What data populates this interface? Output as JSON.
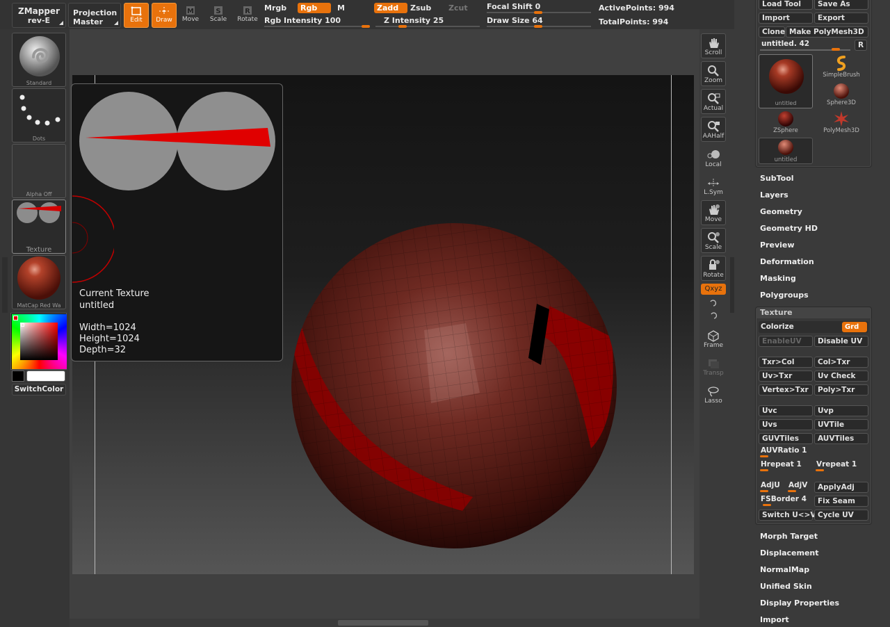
{
  "topbar": {
    "zmapper_label": "ZMapper",
    "zmapper_sub": "rev-E",
    "projection_label": "Projection",
    "projection_sub": "Master",
    "modes": [
      {
        "label": "Edit",
        "active": true
      },
      {
        "label": "Draw",
        "active": true
      },
      {
        "label": "Move",
        "active": false
      },
      {
        "label": "Scale",
        "active": false
      },
      {
        "label": "Rotate",
        "active": false
      }
    ],
    "mrgb": "Mrgb",
    "rgb": "Rgb",
    "m": "M",
    "rgb_intensity": "Rgb Intensity 100",
    "zadd": "Zadd",
    "zsub": "Zsub",
    "zcut": "Zcut",
    "z_intensity": "Z Intensity 25",
    "focal_shift": "Focal Shift 0",
    "draw_size": "Draw Size 64",
    "active_points": "ActivePoints: 994",
    "total_points": "TotalPoints: 994"
  },
  "left_shelf": {
    "standard": "Standard",
    "dots": "Dots",
    "alpha_off": "Alpha Off",
    "texture": "Texture",
    "matcap": "MatCap Red Wa",
    "switch_color": "SwitchColor"
  },
  "popup": {
    "title": "Current Texture",
    "name": "untitled",
    "width": "Width=1024",
    "height": "Height=1024",
    "depth": "Depth=32"
  },
  "right_shelf": [
    {
      "label": "Scroll",
      "icon": "hand-scroll-icon"
    },
    {
      "label": "Zoom",
      "icon": "zoom-icon"
    },
    {
      "label": "Actual",
      "icon": "actual-size-icon"
    },
    {
      "label": "AAHalf",
      "icon": "aahalf-icon"
    },
    {
      "label": "Local",
      "icon": "local-icon"
    },
    {
      "label": "L.Sym",
      "icon": "lsym-icon"
    },
    {
      "label": "Move",
      "icon": "move-hand-icon"
    },
    {
      "label": "Scale",
      "icon": "scale-icon"
    },
    {
      "label": "Rotate",
      "icon": "rotate-icon"
    },
    {
      "label": "Qxyz",
      "icon": "xyz-icon"
    },
    {
      "label": "Frame",
      "icon": "frame-icon"
    },
    {
      "label": "Transp",
      "icon": "transp-icon"
    },
    {
      "label": "Lasso",
      "icon": "lasso-icon"
    }
  ],
  "tool_palette": {
    "load_tool": "Load Tool",
    "save_as": "Save As",
    "import": "Import",
    "export": "Export",
    "clone": "Clone",
    "make_polymesh": "Make PolyMesh3D",
    "current": "untitled. 42",
    "r": "R",
    "tools": [
      {
        "label": "untitled",
        "icon": "sphere-icon"
      },
      {
        "label": "SimpleBrush",
        "icon": "simplebrush-icon"
      },
      {
        "label": "Sphere3D",
        "icon": "sphere3d-icon"
      },
      {
        "label": "ZSphere",
        "icon": "zsphere-icon"
      },
      {
        "label": "PolyMesh3D",
        "icon": "polymesh-star-icon"
      },
      {
        "label": "untitled",
        "icon": "sphere-small-icon"
      }
    ]
  },
  "menus_top": [
    "SubTool",
    "Layers",
    "Geometry",
    "Geometry HD",
    "Preview",
    "Deformation",
    "Masking",
    "Polygroups"
  ],
  "texture_panel": {
    "title": "Texture",
    "colorize": "Colorize",
    "grd": "Grd",
    "enable_uv": "EnableUV",
    "disable_uv": "Disable UV",
    "txr_col": "Txr>Col",
    "col_txr": "Col>Txr",
    "uv_txr": "Uv>Txr",
    "uv_check": "Uv Check",
    "vertex_txr": "Vertex>Txr",
    "poly_txr": "Poly>Txr",
    "uvc": "Uvc",
    "uvp": "Uvp",
    "uvs": "Uvs",
    "uvtile": "UVTile",
    "guvtiles": "GUVTiles",
    "auvtiles": "AUVTiles",
    "auvratio": "AUVRatio 1",
    "hrepeat": "Hrepeat 1",
    "vrepeat": "Vrepeat 1",
    "adju": "AdjU",
    "adjv": "AdjV",
    "applyadj": "ApplyAdj",
    "fsborder": "FSBorder 4",
    "fix_seam": "Fix Seam",
    "switch_uv": "Switch U<>V",
    "cycle_uv": "Cycle UV"
  },
  "menus_bottom": [
    "Morph Target",
    "Displacement",
    "NormalMap",
    "Unified Skin",
    "Display Properties",
    "Import"
  ],
  "colors": {
    "accent": "#e8720c",
    "sphere": "#6a1e16",
    "texture_red": "#d40000"
  }
}
